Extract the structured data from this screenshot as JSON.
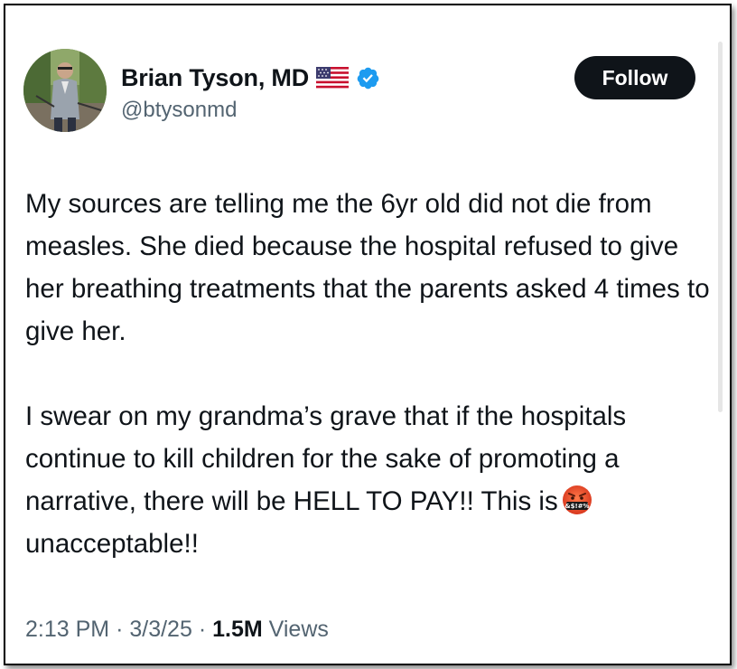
{
  "author": {
    "display_name": "Brian Tyson, MD",
    "handle": "@btysonmd",
    "flag_icon": "us-flag-icon",
    "verified_icon": "verified-badge-icon",
    "verified_color": "#1d9bf0"
  },
  "follow_button": {
    "label": "Follow"
  },
  "tweet": {
    "paragraph1": "My sources are telling me the 6yr old did not die from measles.  She died because the hospital refused to give her breathing treatments that the parents asked 4 times to give her.",
    "paragraph2_start": "I swear on my grandma’s grave that if the hospitals continue to kill children for the sake of promoting a narrative, there will be HELL TO PAY!!  This is",
    "emoji_icon": "cursing-face-emoji-icon",
    "emoji_symbols": "&$!#%",
    "paragraph2_end": "unacceptable!!"
  },
  "meta": {
    "time": "2:13 PM",
    "separator": "·",
    "date": "3/3/25",
    "views_count": "1.5M",
    "views_label": "Views"
  },
  "colors": {
    "text_primary": "#0f1419",
    "text_secondary": "#536471",
    "button_bg": "#0f1419"
  }
}
